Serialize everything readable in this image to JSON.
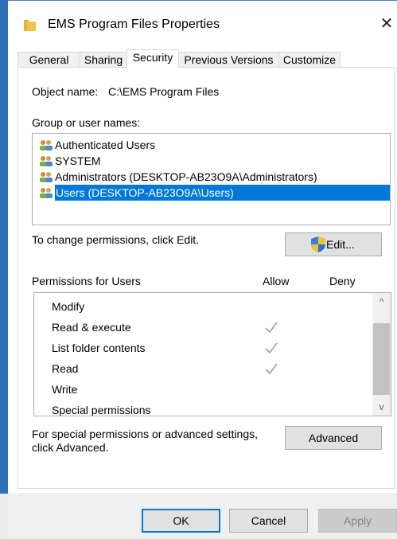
{
  "window": {
    "title": "EMS Program Files Properties",
    "icon": "folder-icon",
    "close_glyph": "✕"
  },
  "tabs": [
    {
      "label": "General",
      "active": false
    },
    {
      "label": "Sharing",
      "active": false
    },
    {
      "label": "Security",
      "active": true
    },
    {
      "label": "Previous Versions",
      "active": false
    },
    {
      "label": "Customize",
      "active": false
    }
  ],
  "object": {
    "label": "Object name:",
    "value": "C:\\EMS Program Files"
  },
  "group_section": {
    "label": "Group or user names:",
    "items": [
      {
        "name": "Authenticated Users",
        "icon": "users-group-icon",
        "selected": false
      },
      {
        "name": "SYSTEM",
        "icon": "users-group-icon",
        "selected": false
      },
      {
        "name": "Administrators (DESKTOP-AB23O9A\\Administrators)",
        "icon": "users-group-icon",
        "selected": false
      },
      {
        "name": "Users (DESKTOP-AB23O9A\\Users)",
        "icon": "users-group-icon",
        "selected": true
      }
    ]
  },
  "change_hint": "To change permissions, click Edit.",
  "edit_button": {
    "label": "Edit...",
    "icon": "uac-shield-icon"
  },
  "permissions": {
    "label": "Permissions for Users",
    "allow_header": "Allow",
    "deny_header": "Deny",
    "rows": [
      {
        "name": "Modify",
        "allow": false,
        "deny": false
      },
      {
        "name": "Read & execute",
        "allow": true,
        "deny": false
      },
      {
        "name": "List folder contents",
        "allow": true,
        "deny": false
      },
      {
        "name": "Read",
        "allow": true,
        "deny": false
      },
      {
        "name": "Write",
        "allow": false,
        "deny": false
      },
      {
        "name": "Special permissions",
        "allow": false,
        "deny": false
      }
    ],
    "scroll_up_glyph": "^",
    "scroll_down_glyph": "v"
  },
  "advanced_hint": {
    "line1": "For special permissions or advanced settings,",
    "line2": "click Advanced."
  },
  "advanced_button": {
    "label": "Advanced"
  },
  "footer": {
    "ok_label": "OK",
    "cancel_label": "Cancel",
    "apply_label": "Apply"
  },
  "colors": {
    "selection": "#0078d7",
    "check_inherited": "#a0a0a0",
    "folder": "#f3c547"
  }
}
